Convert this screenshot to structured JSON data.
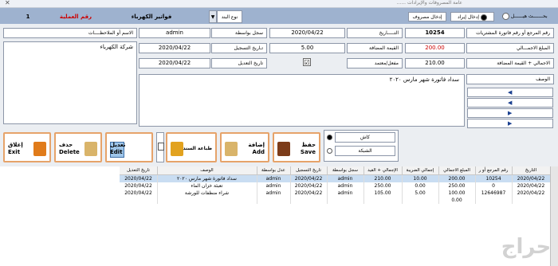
{
  "window": {
    "title": "...... عامة المصروفات والإيرادات",
    "close": "✕"
  },
  "header": {
    "radio_search": "بحـــــــث هيــــــل",
    "radio_income": "إدخال إيراد",
    "expense_btn": "إدخال مصروف",
    "type_label": "نوع البند",
    "type_value": "فواتير الكهرباء",
    "op_label": "رقم العملية",
    "op_value": "1"
  },
  "fields": {
    "ref_label": "رقم المرجع أو رقم فاتورة المشتريات",
    "ref_value": "10254",
    "date_label": "التـــــاريخ",
    "date_value": "2020/04/22",
    "by_label": "سجل بواسطة",
    "by_value": "admin",
    "notes_label": "الاسم أو الملاحظــــات",
    "total_label": "المبلغ الاجمـــالي",
    "total_value": "200.00",
    "tax_label": "القيمة المضافة",
    "tax_value": "5.00",
    "reg_label": "تـاريخ التسجيل",
    "reg_value": "2020/04/22",
    "notes_value": "شركة الكهرباء",
    "sum_label": "الاجمالي + القيمة المضافة",
    "sum_value": "210.00",
    "active_label": "مفعل/معتمد",
    "edit_label": "تاريخ التعديل",
    "edit_value": "2020/04/22",
    "desc_label": "الوصف",
    "desc_value": "سداد فاتورة شهر مارس ٢٠٢٠"
  },
  "buttons": {
    "save": "حفظ\nSave",
    "add": "إضافة\nAdd",
    "print": "طباعة السند",
    "edit": "تعديل\nEdit",
    "delete": "حذف\nDelete",
    "exit": "إغلاق\nExit",
    "cash": "كاش",
    "check": "الشبكة"
  },
  "nav": {
    "first": "◀",
    "prev": "◀",
    "next": "▶",
    "last": "▶"
  },
  "table": {
    "columns": [
      "التاريخ",
      "رقم المرجع أو ر",
      "المبلغ الاجمالي",
      "إجمالي الضريبة",
      "الإجمالي + القيد",
      "سجل بواسطة",
      "تاريخ التسجيل",
      "عدل بواسطة",
      "الوصف",
      "تاريخ التعديل"
    ],
    "rows": [
      [
        "2020/04/22",
        "10254",
        "200.00",
        "10.00",
        "210.00",
        "admin",
        "2020/04/22",
        "admin",
        "سداد فاتورة شهر مارس ٢٠٢٠",
        "2020/04/22"
      ],
      [
        "2020/04/22",
        "0",
        "250.00",
        "0.00",
        "250.00",
        "admin",
        "2020/04/22",
        "admin",
        "تعبئة خزان الماء",
        "2020/04/22"
      ],
      [
        "2020/04/22",
        "12646987",
        "100.00",
        "5.00",
        "105.00",
        "admin",
        "2020/04/22",
        "admin",
        "شراء منظفات للورشة",
        "2020/04/22"
      ],
      [
        "",
        "",
        "0.00",
        "",
        "",
        "",
        "",
        "",
        "",
        ""
      ]
    ]
  },
  "watermark": "حراج"
}
